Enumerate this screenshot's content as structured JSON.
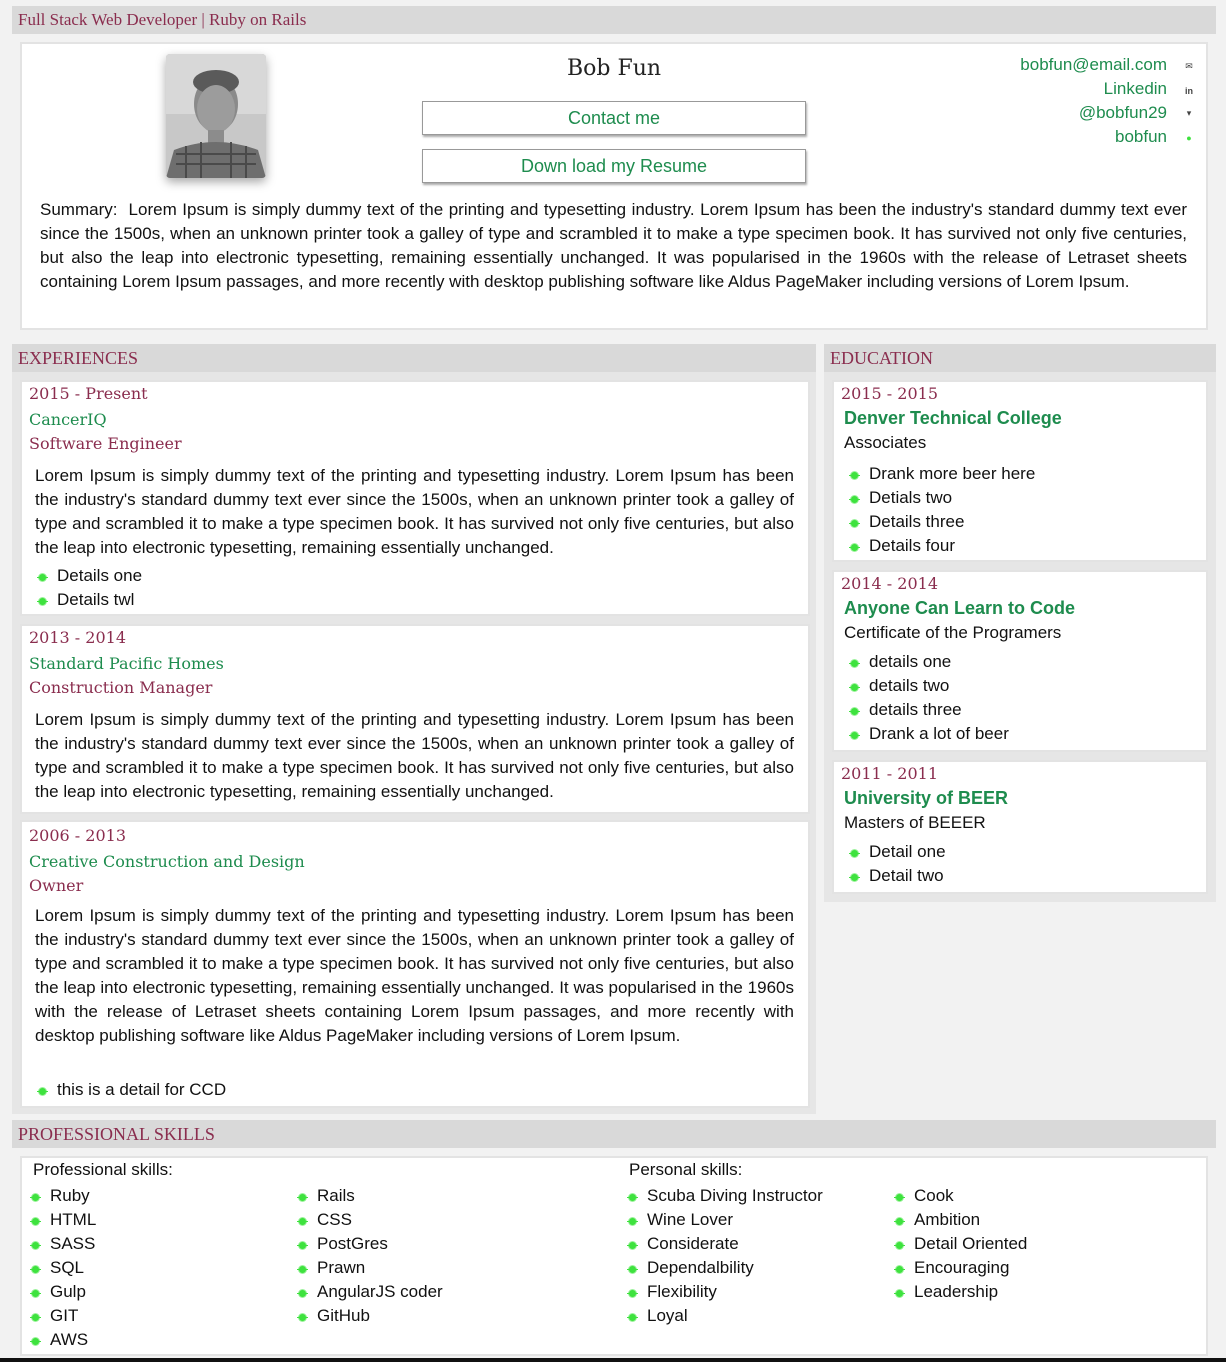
{
  "header": {
    "title": "Full Stack Web Developer | Ruby on Rails"
  },
  "profile": {
    "name": "Bob Fun",
    "contact_button": "Contact me",
    "resume_button": "Down load my Resume",
    "contacts": [
      {
        "label": "bobfun@email.com",
        "icon": "envelope-icon"
      },
      {
        "label": "Linkedin",
        "icon": "linkedin-icon"
      },
      {
        "label": "@bobfun29",
        "icon": "twitter-icon"
      },
      {
        "label": "bobfun",
        "icon": "skype-icon"
      }
    ],
    "summary_label": "Summary:",
    "summary": "Lorem Ipsum is simply dummy text of the printing and typesetting industry. Lorem Ipsum has been the industry's standard dummy text ever since the 1500s, when an unknown printer took a galley of type and scrambled it to make a type specimen book. It has survived not only five centuries, but also the leap into electronic typesetting, remaining essentially unchanged. It was popularised in the 1960s with the release of Letraset sheets containing Lorem Ipsum passages, and more recently with desktop publishing software like Aldus PageMaker including versions of Lorem Ipsum."
  },
  "experiences": {
    "heading": "EXPERIENCES",
    "items": [
      {
        "dates": "2015 - Present",
        "company": "CancerIQ",
        "role": "Software Engineer",
        "description": "Lorem Ipsum is simply dummy text of the printing and typesetting industry. Lorem Ipsum has been the industry's standard dummy text ever since the 1500s, when an unknown printer took a galley of type and scrambled it to make a type specimen book. It has survived not only five centuries, but also the leap into electronic typesetting, remaining essentially unchanged.",
        "details": [
          "Details one",
          "Details twl"
        ]
      },
      {
        "dates": "2013 - 2014",
        "company": "Standard Pacific Homes",
        "role": "Construction Manager",
        "description": "Lorem Ipsum is simply dummy text of the printing and typesetting industry. Lorem Ipsum has been the industry's standard dummy text ever since the 1500s, when an unknown printer took a galley of type and scrambled it to make a type specimen book. It has survived not only five centuries, but also the leap into electronic typesetting, remaining essentially unchanged.",
        "details": []
      },
      {
        "dates": "2006 - 2013",
        "company": "Creative Construction and Design",
        "role": "Owner",
        "description": "Lorem Ipsum is simply dummy text of the printing and typesetting industry. Lorem Ipsum has been the industry's standard dummy text ever since the 1500s, when an unknown printer took a galley of type and scrambled it to make a type specimen book. It has survived not only five centuries, but also the leap into electronic typesetting, remaining essentially unchanged. It was popularised in the 1960s with the release of Letraset sheets containing Lorem Ipsum passages, and more recently with desktop publishing software like Aldus PageMaker including versions of Lorem Ipsum.",
        "details": [
          "this is a detail for CCD"
        ]
      }
    ]
  },
  "education": {
    "heading": "EDUCATION",
    "items": [
      {
        "dates": "2015 - 2015",
        "school": "Denver Technical College",
        "degree": "Associates",
        "details": [
          "Drank more beer here",
          "Detials two",
          "Details three",
          "Details four"
        ]
      },
      {
        "dates": "2014 - 2014",
        "school": "Anyone Can Learn to Code",
        "degree": "Certificate of the Programers",
        "details": [
          "details one",
          "details two",
          "details three",
          "Drank a lot of beer"
        ]
      },
      {
        "dates": "2011 - 2011",
        "school": "University of BEER",
        "degree": "Masters of BEEER",
        "details": [
          "Detail one",
          "Detail two"
        ]
      }
    ]
  },
  "skills": {
    "heading": "PROFESSIONAL SKILLS",
    "professional_label": "Professional skills:",
    "professional_col1": [
      "Ruby",
      "HTML",
      "SASS",
      "SQL",
      "Gulp",
      "GIT",
      "AWS"
    ],
    "professional_col2": [
      "Rails",
      "CSS",
      "PostGres",
      "Prawn",
      "AngularJS coder",
      "GitHub"
    ],
    "personal_label": "Personal skills:",
    "personal_col1": [
      "Scuba Diving Instructor",
      "Wine Lover",
      "Considerate",
      "Dependalbility",
      "Flexibility",
      "Loyal"
    ],
    "personal_col2": [
      "Cook",
      "Ambition",
      "Detail Oriented",
      "Encouraging",
      "Leadership"
    ]
  },
  "colors": {
    "accent_green": "#1e8c4e",
    "accent_maroon": "#8a2d4e",
    "bullet_green": "#3ee23e",
    "bar_gray": "#d9d9d9"
  }
}
